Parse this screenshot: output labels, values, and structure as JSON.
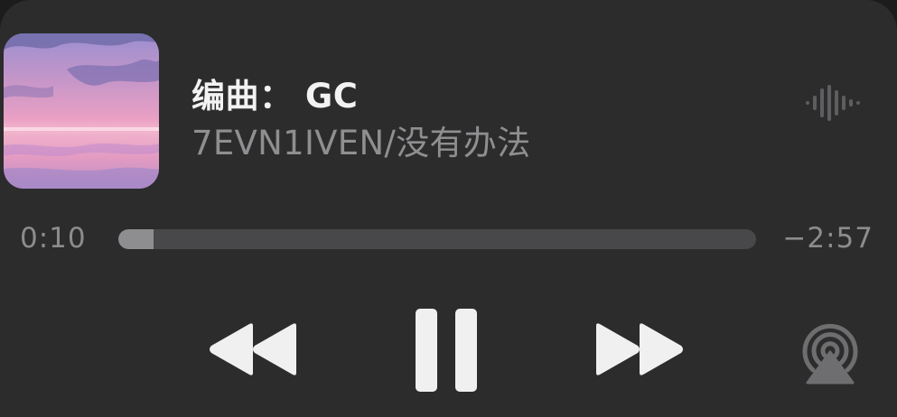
{
  "now_playing": {
    "title": "编曲： GC",
    "subtitle": "7EVN1IVEN/没有办法",
    "artwork_icon": "album-artwork-pink-sky"
  },
  "progress": {
    "elapsed": "0:10",
    "remaining": "−2:57",
    "fraction": 0.055
  },
  "controls": {
    "rewind_icon": "rewind-icon",
    "pause_icon": "pause-icon",
    "forward_icon": "fast-forward-icon",
    "airplay_icon": "airplay-audio-icon",
    "waveform_icon": "audio-waveform-icon"
  },
  "colors": {
    "background": "#2c2c2d",
    "title": "#f2f2f2",
    "secondary": "#8f8f91",
    "track": "#48484a",
    "track_fill": "#8e8e90",
    "controls": "#f0f0f0"
  }
}
